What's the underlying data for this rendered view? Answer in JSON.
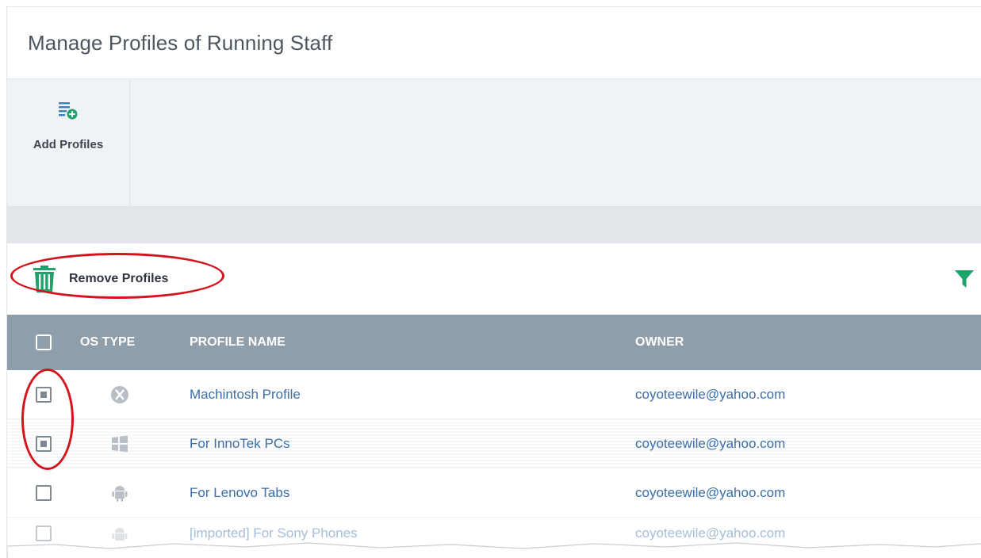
{
  "page": {
    "title": "Manage Profiles of Running Staff"
  },
  "toolbar": {
    "add_profiles_label": "Add Profiles"
  },
  "actions": {
    "remove_profiles_label": "Remove Profiles"
  },
  "table": {
    "headers": {
      "os_type": "OS TYPE",
      "profile_name": "PROFILE NAME",
      "owner": "OWNER"
    },
    "rows": [
      {
        "os": "mac-os-icon",
        "name": "Machintosh Profile",
        "owner": "coyoteewile@yahoo.com",
        "checked": true
      },
      {
        "os": "windows-icon",
        "name": "For InnoTek PCs",
        "owner": "coyoteewile@yahoo.com",
        "checked": true
      },
      {
        "os": "android-icon",
        "name": "For Lenovo Tabs",
        "owner": "coyoteewile@yahoo.com",
        "checked": false
      },
      {
        "os": "android-icon",
        "name": "[imported] For Sony Phones",
        "owner": "coyoteewile@yahoo.com",
        "checked": false
      }
    ]
  },
  "colors": {
    "accent_green": "#1fa36b",
    "header_bg": "#8f9eab",
    "link": "#3a6ea8",
    "highlight": "#d4141c"
  }
}
